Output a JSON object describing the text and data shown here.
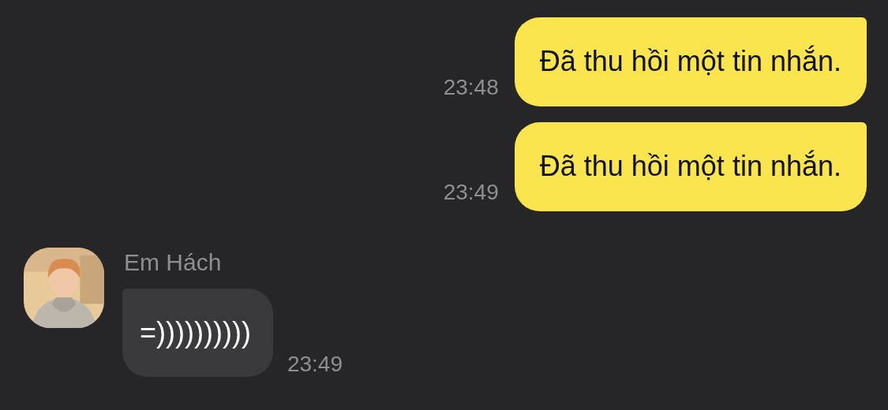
{
  "messages": [
    {
      "kind": "outgoing",
      "text": "Đã thu hồi một tin nhắn.",
      "time": "23:48"
    },
    {
      "kind": "outgoing",
      "text": "Đã thu hồi một tin nhắn.",
      "time": "23:49"
    },
    {
      "kind": "incoming",
      "sender": "Em Hách",
      "text": "=))))))))))",
      "time": "23:49"
    }
  ]
}
